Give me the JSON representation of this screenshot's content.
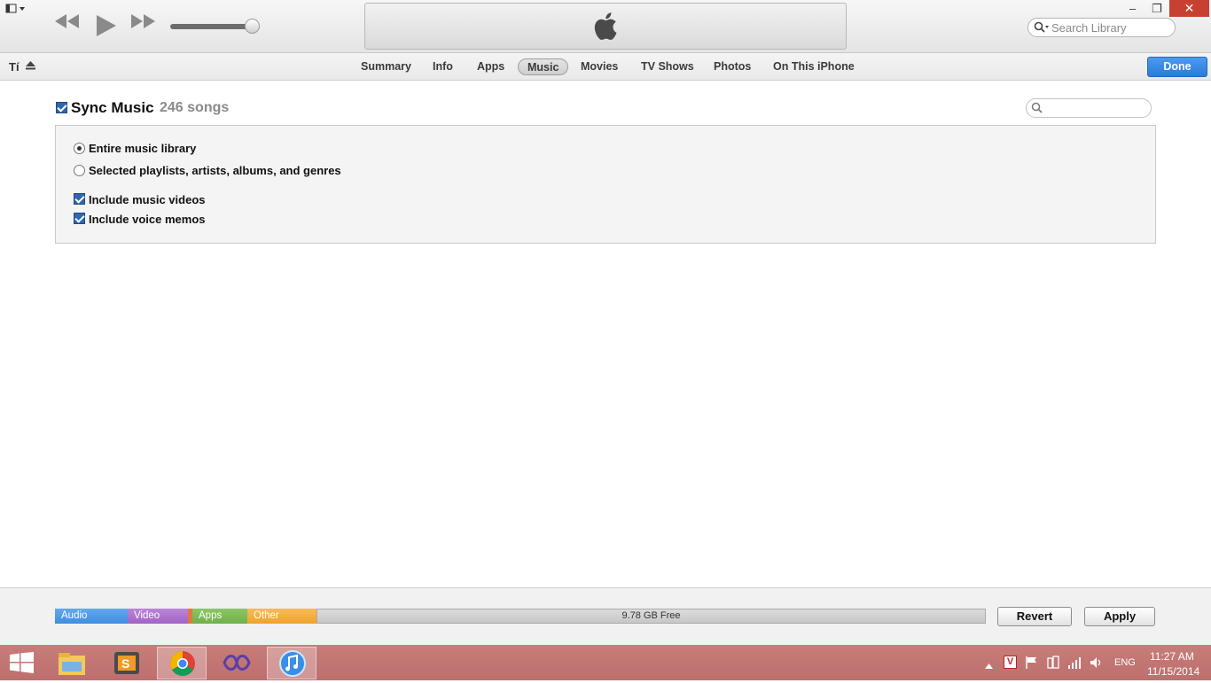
{
  "window": {
    "search_placeholder": "Search Library",
    "close_glyph": "✕",
    "maximize_glyph": "❐",
    "minimize_glyph": "–"
  },
  "device": {
    "name": "Tí"
  },
  "tabs": [
    {
      "label": "Summary"
    },
    {
      "label": "Info"
    },
    {
      "label": "Apps"
    },
    {
      "label": "Music",
      "active": true
    },
    {
      "label": "Movies"
    },
    {
      "label": "TV Shows"
    },
    {
      "label": "Photos"
    },
    {
      "label": "On This iPhone"
    }
  ],
  "done_label": "Done",
  "sync": {
    "title": "Sync Music",
    "count": "246 songs",
    "checked": true
  },
  "options": {
    "entire": "Entire music library",
    "selected": "Selected playlists, artists, albums, and genres",
    "videos": "Include music videos",
    "memos": "Include voice memos"
  },
  "capacity": {
    "segments": [
      {
        "label": "Audio",
        "color": "#3f8ee0"
      },
      {
        "label": "Video",
        "color": "#a264c4"
      },
      {
        "label": "Apps",
        "color": "#6fb14a"
      },
      {
        "label": "Other",
        "color": "#f0a32c"
      }
    ],
    "free_label": "9.78 GB Free"
  },
  "buttons": {
    "revert": "Revert",
    "apply": "Apply"
  },
  "taskbar": {
    "lang": "ENG",
    "time": "11:27 AM",
    "date": "11/15/2014"
  },
  "colors": {
    "accent": "#2b7bd8",
    "taskbar": "#c47775"
  }
}
